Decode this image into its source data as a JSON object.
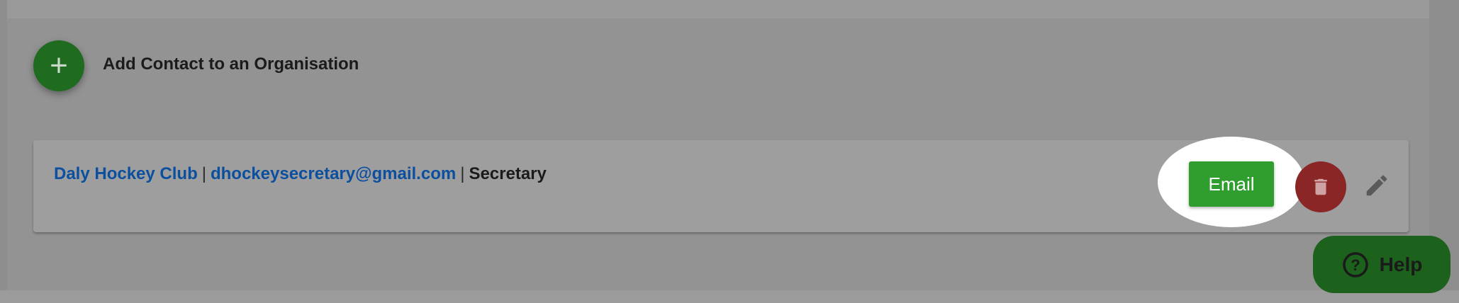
{
  "add_section": {
    "fab_symbol": "+",
    "label": "Add Contact to an Organisation"
  },
  "contacts": [
    {
      "organisation": "Daly Hockey Club",
      "email": "dhockeysecretary@gmail.com",
      "role": "Secretary",
      "separator": "|",
      "email_button_label": "Email"
    }
  ],
  "help": {
    "icon_text": "?",
    "label": "Help"
  },
  "icons": {
    "add": "plus-icon",
    "delete": "trash-icon",
    "edit": "pencil-icon",
    "help": "question-circle-icon"
  },
  "colors": {
    "overlay_bg": "#8e8e8e",
    "fab_green": "#1f6b1f",
    "email_button": "#2f9e2f",
    "delete_red": "#8a2626",
    "link_blue": "#0b4f9e",
    "help_green": "#1c611c",
    "highlight": "#ffffff"
  }
}
